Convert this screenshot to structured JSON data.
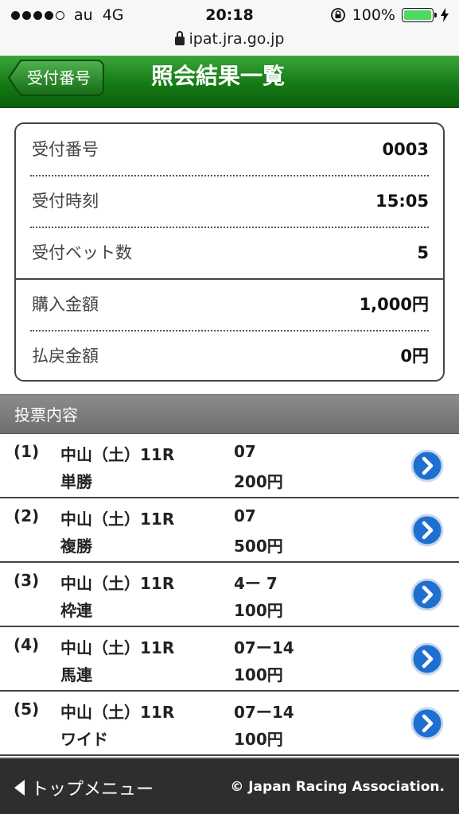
{
  "status": {
    "carrier": "au",
    "network": "4G",
    "time": "20:18",
    "battery": "100%",
    "url": "ipat.jra.go.jp"
  },
  "header": {
    "back_label": "受付番号",
    "title": "照会結果一覧"
  },
  "info": [
    {
      "label": "受付番号",
      "value": "0003"
    },
    {
      "label": "受付時刻",
      "value": "15:05"
    },
    {
      "label": "受付ベット数",
      "value": "5"
    },
    {
      "label": "購入金額",
      "value": "1,000円"
    },
    {
      "label": "払戻金額",
      "value": "0円"
    }
  ],
  "section_title": "投票内容",
  "bets": [
    {
      "no": "(1)",
      "race": "中山（土）11R",
      "type": "単勝",
      "combo": "07",
      "amount": "200円"
    },
    {
      "no": "(2)",
      "race": "中山（土）11R",
      "type": "複勝",
      "combo": "07",
      "amount": "500円"
    },
    {
      "no": "(3)",
      "race": "中山（土）11R",
      "type": "枠連",
      "combo": "4ー 7",
      "amount": "100円"
    },
    {
      "no": "(4)",
      "race": "中山（土）11R",
      "type": "馬連",
      "combo": "07ー14",
      "amount": "100円"
    },
    {
      "no": "(5)",
      "race": "中山（土）11R",
      "type": "ワイド",
      "combo": "07ー14",
      "amount": "100円"
    }
  ],
  "footer": {
    "menu_label": "トップメニュー",
    "copyright": "© Japan Racing Association."
  },
  "colors": {
    "header_green": "#157a15",
    "section_gray": "#7a7a7a",
    "chevron_blue": "#1e6fd0",
    "footer_dark": "#2e2e2e"
  }
}
